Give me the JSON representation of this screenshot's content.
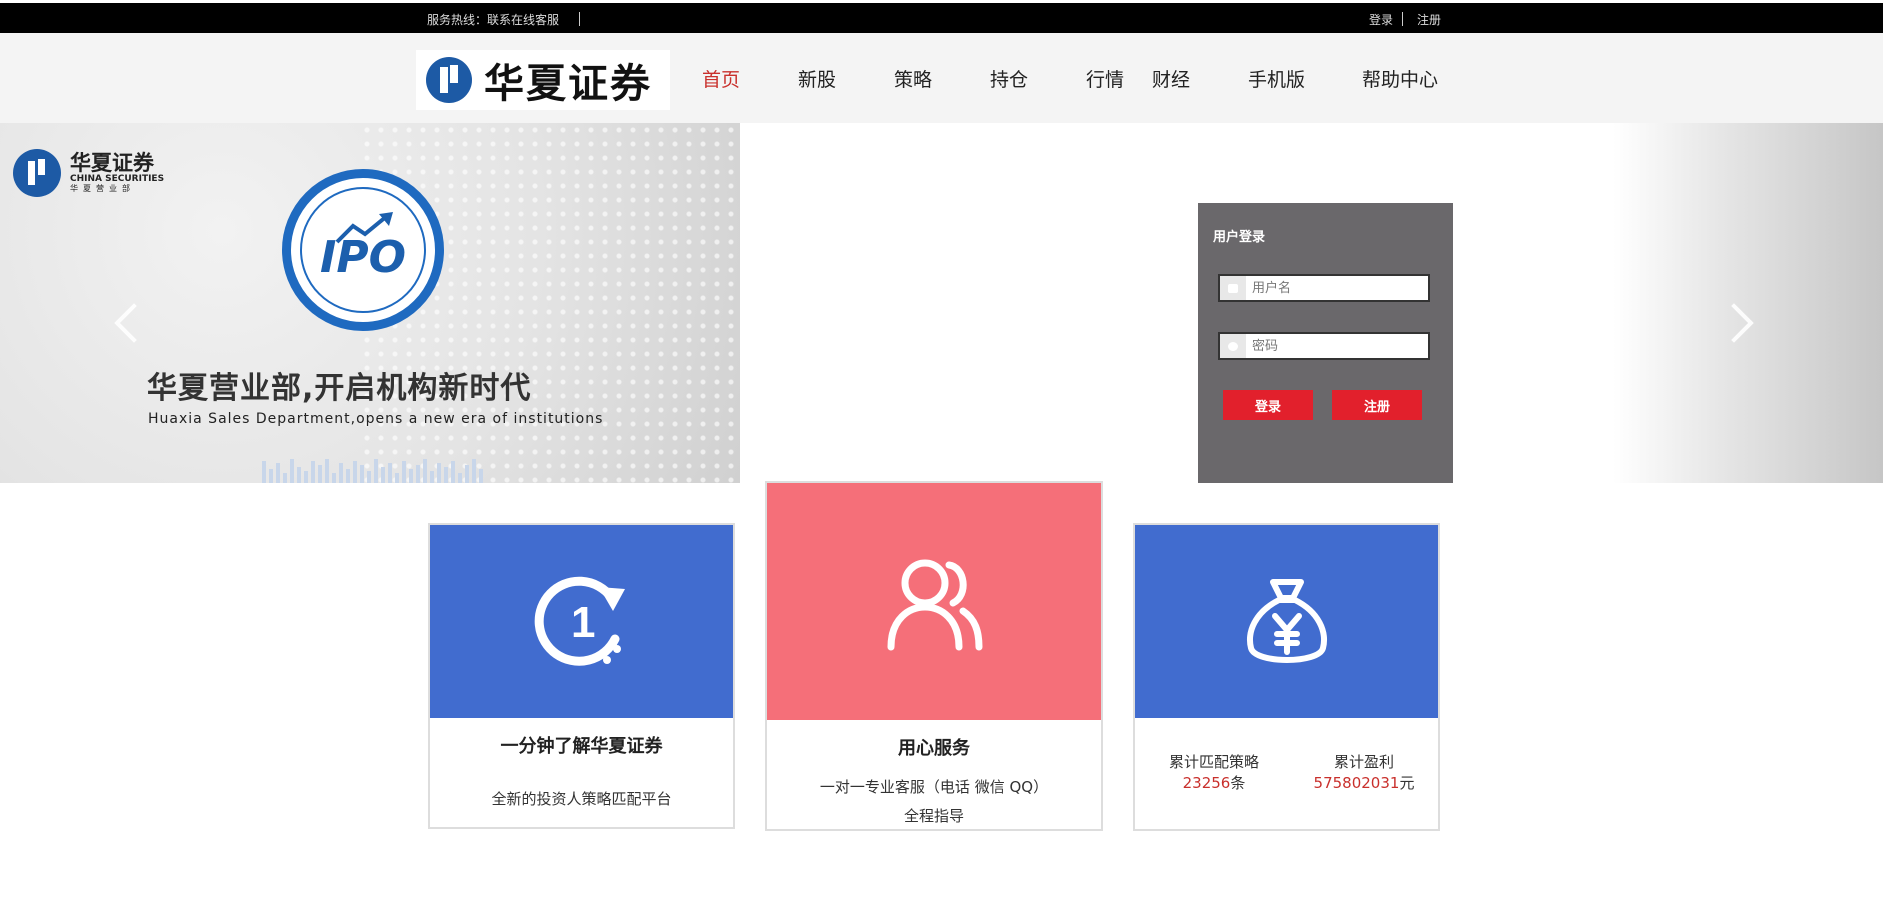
{
  "topbar": {
    "hotline": "服务热线：联系在线客服",
    "login": "登录",
    "register": "注册"
  },
  "header": {
    "logo_text": "华夏证券",
    "nav": [
      "首页",
      "新股",
      "策略",
      "持仓",
      "行情",
      "财经",
      "手机版",
      "帮助中心"
    ],
    "active_nav": "首页"
  },
  "banner": {
    "logo_cn": "华夏证券",
    "logo_en": "CHINA SECURITIES",
    "logo_sub": "华夏营业部",
    "badge": "IPO",
    "title": "华夏营业部,开启机构新时代",
    "subtitle": "Huaxia Sales Department,opens a new era of institutions"
  },
  "login_panel": {
    "title": "用户登录",
    "username_placeholder": "用户名",
    "password_placeholder": "密码",
    "login_button": "登录",
    "register_button": "注册"
  },
  "cards": {
    "intro": {
      "title": "一分钟了解华夏证券",
      "desc": "全新的投资人策略匹配平台",
      "icon": "one-minute-clock-icon"
    },
    "service": {
      "title": "用心服务",
      "desc_line1": "一对一专业客服（电话 微信 QQ）",
      "desc_line2": "全程指导",
      "icon": "users-icon"
    },
    "stats": {
      "icon": "money-bag-yen-icon",
      "strategies_label": "累计匹配策略",
      "strategies_value": "23256",
      "strategies_unit": "条",
      "profit_label": "累计盈利",
      "profit_value": "575802031",
      "profit_unit": "元"
    }
  },
  "colors": {
    "brand_blue": "#1d5aa5",
    "card_blue": "#416ccf",
    "card_pink": "#f56f79",
    "login_bg": "#6a686b",
    "accent_red": "#e2202c",
    "number_red": "#c9302c"
  }
}
